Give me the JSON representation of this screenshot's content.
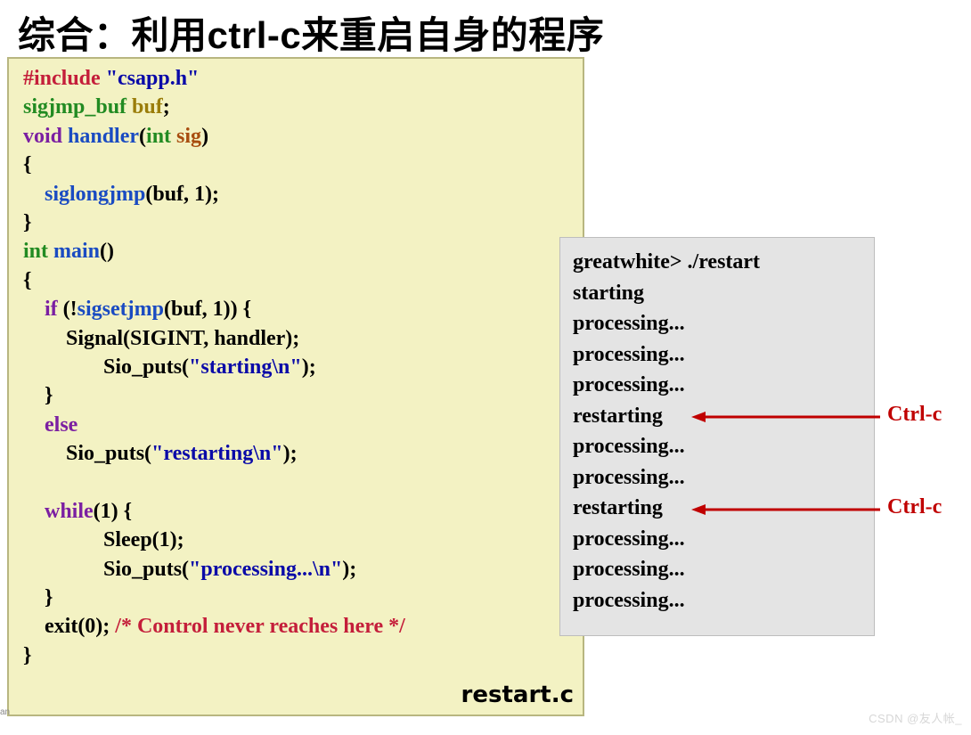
{
  "title": "综合：利用ctrl-c来重启自身的程序",
  "code": {
    "filename": "restart.c",
    "l1a": "#include ",
    "l1b": "\"csapp.h\"",
    "l2a": "sigjmp_buf ",
    "l2b": "buf",
    "l2c": ";",
    "l3a": "void ",
    "l3b": "handler",
    "l3c": "(",
    "l3d": "int ",
    "l3e": "sig",
    "l3f": ")",
    "l4": "{",
    "l5a": "    siglongjmp",
    "l5b": "(buf, 1);",
    "l6": "}",
    "l7a": "int ",
    "l7b": "main",
    "l7c": "()",
    "l8": "{",
    "l9a": "    if ",
    "l9b": "(!",
    "l9c": "sigsetjmp",
    "l9d": "(buf, 1)) {",
    "l10": "        Signal(SIGINT, handler);",
    "l11a": "               Sio_puts(",
    "l11b": "\"starting\\n\"",
    "l11c": ");",
    "l12": "    }",
    "l13": "    else",
    "l14a": "        Sio_puts(",
    "l14b": "\"restarting\\n\"",
    "l14c": ");",
    "blank": " ",
    "l15a": "    while",
    "l15b": "(1) {",
    "l16": "               Sleep(1);",
    "l17a": "               Sio_puts(",
    "l17b": "\"processing...\\n\"",
    "l17c": ");",
    "l18": "    }",
    "l19a": "    exit(0); ",
    "l19b": "/* Control never reaches here */",
    "l20": "}"
  },
  "output": {
    "lines": [
      "greatwhite> ./restart",
      "starting",
      "processing...",
      "processing...",
      "processing...",
      "restarting",
      "processing...",
      "processing...",
      "restarting",
      "processing...",
      "processing...",
      "processing..."
    ]
  },
  "labels": {
    "ctrlc": "Ctrl-c"
  },
  "watermark": "CSDN @友人帐_",
  "side_tag": "an"
}
